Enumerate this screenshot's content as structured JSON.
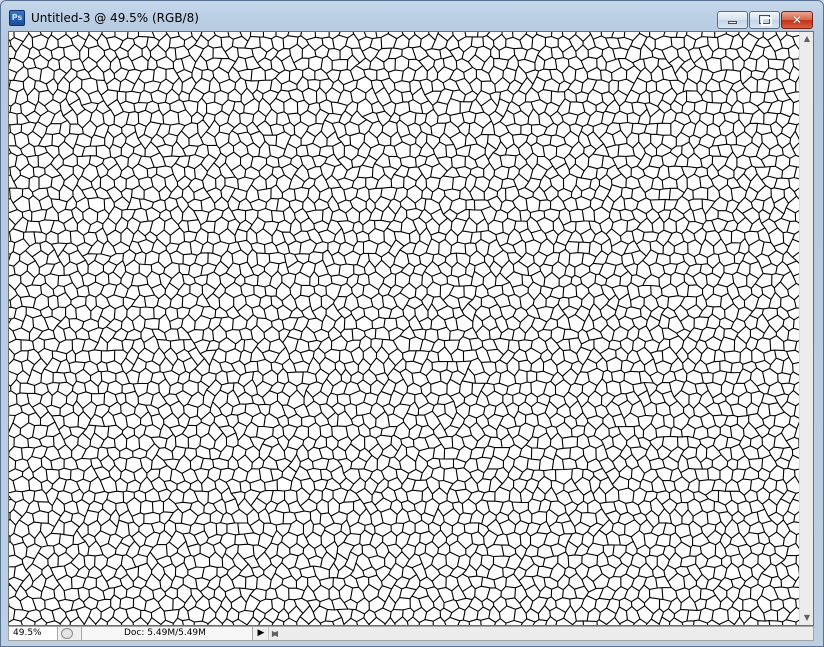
{
  "window": {
    "app_icon_label": "Ps",
    "title": "Untitled-3 @ 49.5% (RGB/8)",
    "close_glyph": "✕"
  },
  "canvas": {
    "pattern": "cellular-polygon-texture",
    "line_color": "#000000",
    "fill_color": "#ffffff"
  },
  "scrollbars": {
    "up_arrow": "▲",
    "down_arrow": "▼",
    "left_arrow": "◀",
    "right_arrow": "▶"
  },
  "status": {
    "zoom": "49.5%",
    "doc_info": "Doc: 5.49M/5.49M",
    "menu_arrow": "▶"
  }
}
